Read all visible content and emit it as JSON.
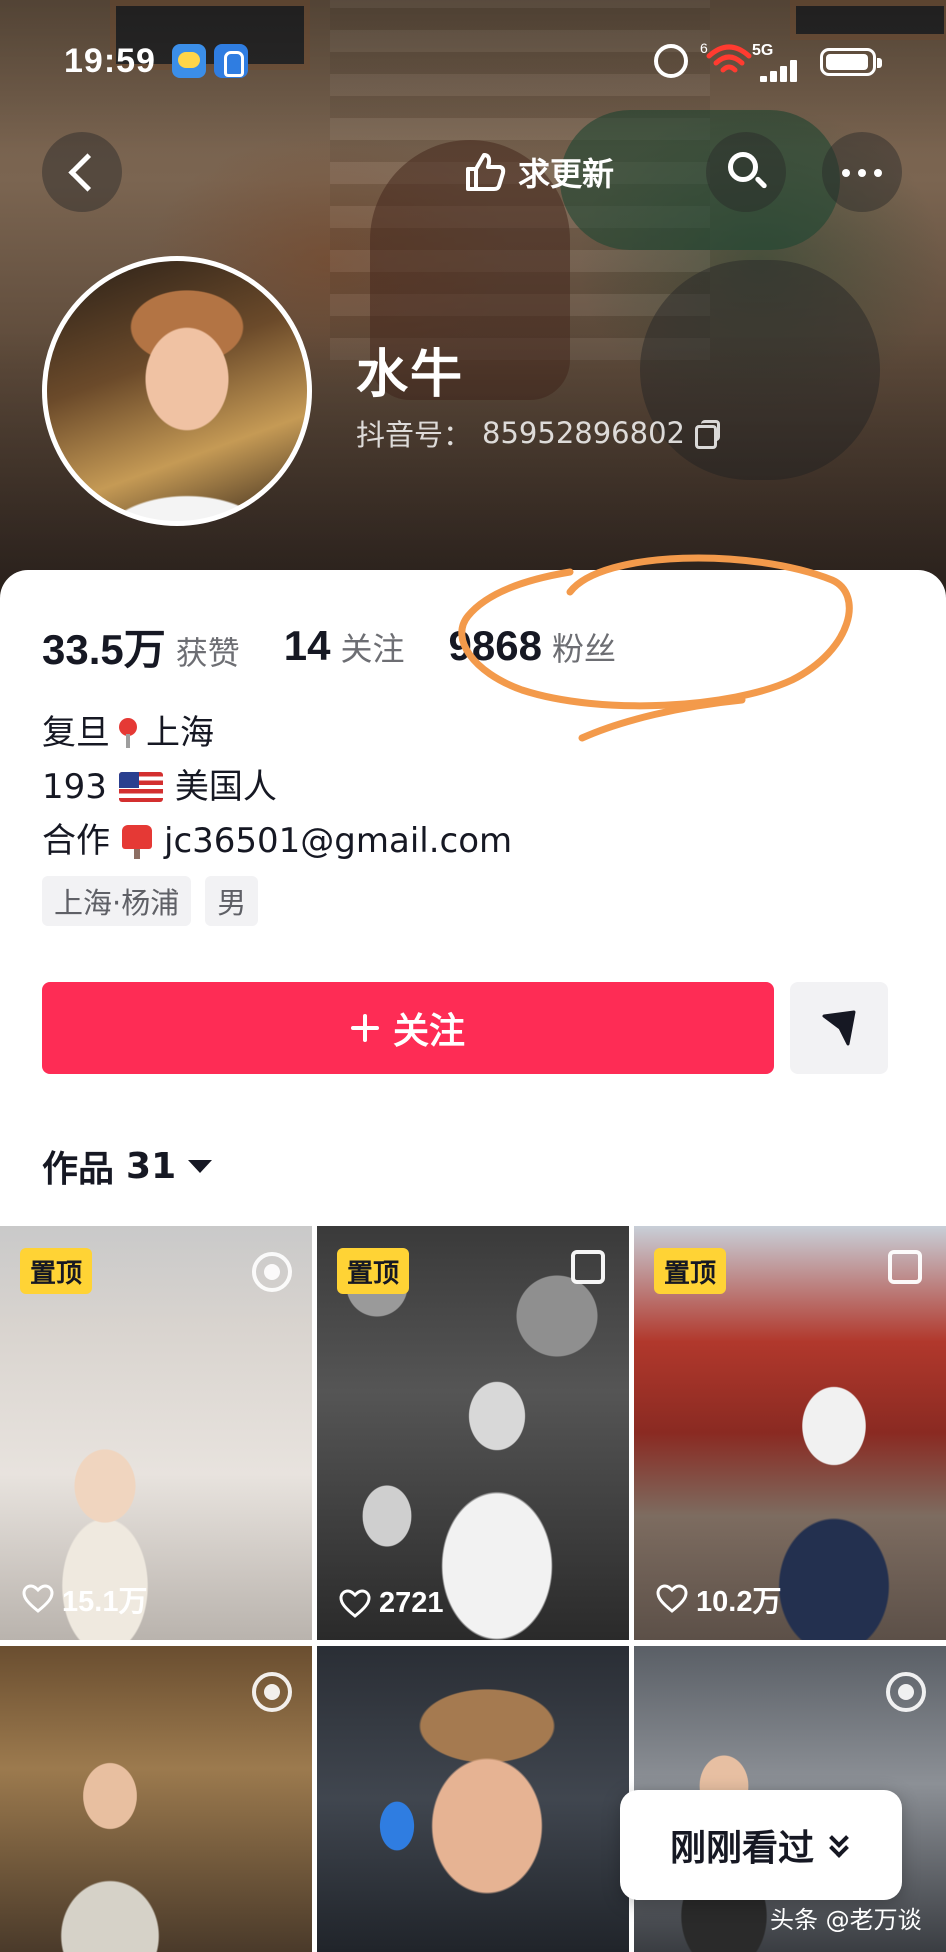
{
  "status_bar": {
    "time": "19:59",
    "network_badge": "6",
    "network_type": "5G",
    "icons": [
      "weather-icon",
      "wallet-icon",
      "alarm-icon",
      "wifi-icon",
      "signal-icon",
      "battery-icon"
    ]
  },
  "nav": {
    "update_label": "求更新",
    "icons": [
      "back-icon",
      "thumb-icon",
      "search-icon",
      "more-icon"
    ]
  },
  "profile": {
    "name": "水牛",
    "id_label": "抖音号：",
    "id_value": "85952896802"
  },
  "stats": [
    {
      "value": "33.5万",
      "label": "获赞"
    },
    {
      "value": "14",
      "label": "关注"
    },
    {
      "value": "9868",
      "label": "粉丝"
    }
  ],
  "annotation_color": "#f39a4b",
  "bio": {
    "line1_a": "复旦",
    "line1_b": "上海",
    "line2_a": "193",
    "line2_b": "美国人",
    "line3_a": "合作",
    "line3_b": "jc36501@gmail.com"
  },
  "tags": [
    "上海·杨浦",
    "男"
  ],
  "actions": {
    "follow_label": "关注",
    "follow_color": "#fe2c55"
  },
  "works": {
    "label": "作品",
    "count": "31"
  },
  "tiles": [
    {
      "pinned": "置顶",
      "likes": "15.1万",
      "corner": "live"
    },
    {
      "pinned": "置顶",
      "likes": "2721",
      "corner": "multi"
    },
    {
      "pinned": "置顶",
      "likes": "10.2万",
      "corner": "multi"
    },
    {
      "corner": "live"
    },
    {},
    {
      "corner": "live"
    }
  ],
  "recent": {
    "label": "刚刚看过"
  },
  "watermark": "头条 @老万谈"
}
